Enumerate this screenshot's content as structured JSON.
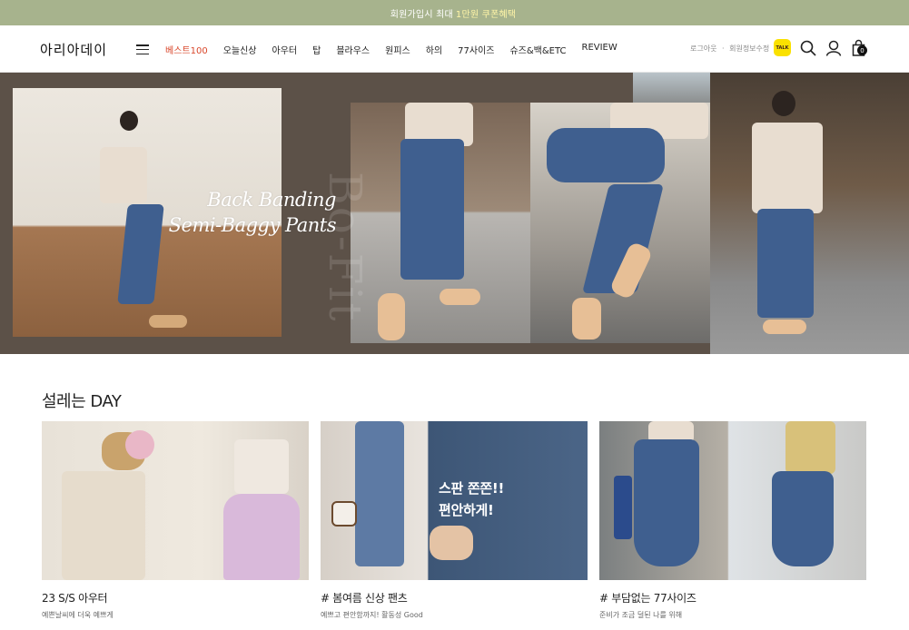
{
  "topbar": {
    "prefix": "회원가입시 최대",
    "highlight": "1만원 쿠폰혜택"
  },
  "header": {
    "logo": "아리아데이",
    "nav": [
      "베스트100",
      "오늘신상",
      "아우터",
      "탑",
      "블라우스",
      "원피스",
      "하의",
      "77사이즈",
      "슈즈&백&ETC",
      "REVIEW"
    ],
    "util_login": "로그아웃",
    "util_sep": "·",
    "util_edit": "회원정보수정",
    "talk_label": "TALK",
    "cart_count": "0",
    "icons": [
      "menu-icon",
      "kakao-talk-icon",
      "search-icon",
      "user-icon",
      "shopping-bag-icon"
    ]
  },
  "hero": {
    "title_line1": "Back Banding",
    "title_line2": "Semi-Baggy Pants",
    "vertical_text": "Bo-Fit"
  },
  "section": {
    "title": "설레는 DAY",
    "cards": [
      {
        "name": "23 S/S 아우터",
        "desc": "예쁜날씨에 더욱 예쁘게",
        "overlay": ""
      },
      {
        "name": "# 봄여름 신상 팬츠",
        "desc": "예쁘고 편안함까지! 활동성 Good",
        "overlay1": "스판 쫀쫀!!",
        "overlay2": "편안하게!"
      },
      {
        "name": "# 부담없는 77사이즈",
        "desc": "준비가 조금 덜된 나를 위해",
        "overlay": ""
      }
    ]
  },
  "colors": {
    "topbar": "#a7b38d",
    "hero_bg": "#5c5148",
    "nav_active": "#d9472b",
    "kakao": "#fae100"
  }
}
